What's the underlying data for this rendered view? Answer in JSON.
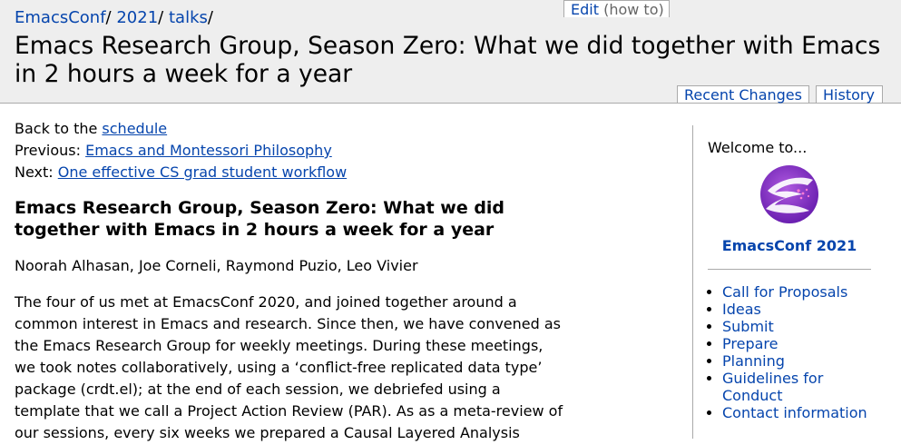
{
  "breadcrumb": {
    "items": [
      "EmacsConf",
      "2021",
      "talks"
    ],
    "separator": "/"
  },
  "page_title": "Emacs Research Group, Season Zero: What we did together with Emacs in 2 hours a week for a year",
  "actions": {
    "edit": "Edit",
    "how_to": "(how to)",
    "recent_changes": "Recent Changes",
    "history": "History"
  },
  "nav": {
    "back_prefix": "Back to the ",
    "back_link": "schedule",
    "previous_prefix": "Previous: ",
    "previous_link": "Emacs and Montessori Philosophy",
    "next_prefix": "Next: ",
    "next_link": "One effective CS grad student workflow"
  },
  "talk": {
    "title": "Emacs Research Group, Season Zero: What we did together with Emacs in 2 hours a week for a year",
    "speakers": "Noorah Alhasan, Joe Corneli, Raymond Puzio, Leo Vivier",
    "abstract": "The four of us met at EmacsConf 2020, and joined together around a common interest in Emacs and research. Since then, we have convened as the Emacs Research Group for weekly meetings. During these meetings, we took notes collaboratively, using a ‘conflict-free replicated data type’ package (crdt.el); at the end of each session, we debriefed using a template that we call a Project Action Review (PAR). As as a meta-review of our sessions, every six weeks we prepared a Causal Layered Analysis"
  },
  "sidebar": {
    "welcome": "Welcome to...",
    "logo_icon": "emacsconf-logo-icon",
    "conf_name": "EmacsConf 2021",
    "links": [
      "Call for Proposals",
      "Ideas",
      "Submit",
      "Prepare",
      "Planning",
      "Guidelines for Conduct",
      "Contact information"
    ]
  },
  "colors": {
    "link": "#0645ad",
    "header_bg": "#eeeeee",
    "border": "#aaaaaa",
    "logo_purple": "#8a2be2"
  }
}
